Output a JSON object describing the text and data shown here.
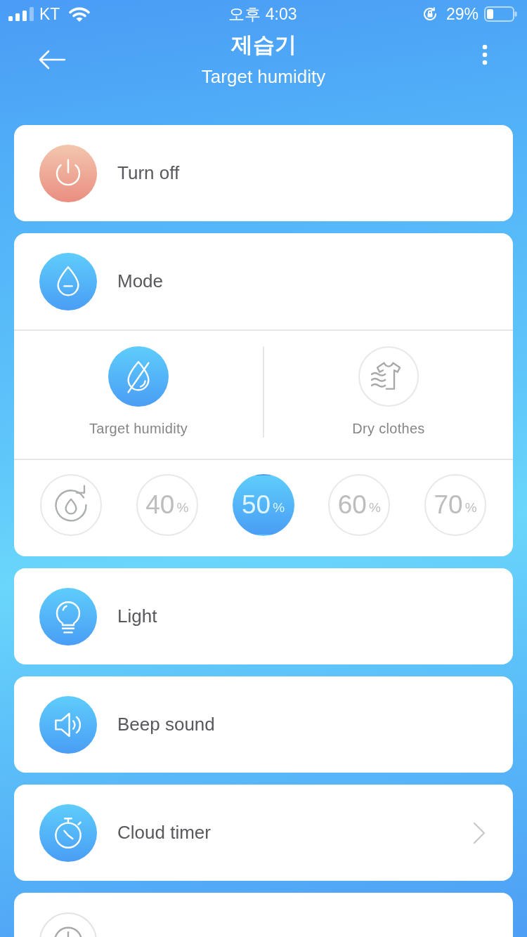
{
  "status_bar": {
    "carrier": "KT",
    "time": "오후 4:03",
    "battery": "29%"
  },
  "header": {
    "title": "제습기",
    "subtitle": "Target humidity"
  },
  "sections": [
    {
      "kind": "power",
      "label": "Turn off",
      "active": true,
      "chevron": false
    },
    {
      "kind": "mode",
      "label": "Mode",
      "active": true,
      "options": [
        {
          "kind": "humidity",
          "label": "Target humidity",
          "selected": true
        },
        {
          "kind": "clothes",
          "label": "Dry clothes",
          "selected": false
        }
      ],
      "levels": [
        {
          "kind": "auto",
          "selected": false
        },
        {
          "kind": "value",
          "value": "40",
          "unit": "%",
          "selected": false
        },
        {
          "kind": "value",
          "value": "50",
          "unit": "%",
          "selected": true
        },
        {
          "kind": "value",
          "value": "60",
          "unit": "%",
          "selected": false
        },
        {
          "kind": "value",
          "value": "70",
          "unit": "%",
          "selected": false
        }
      ]
    },
    {
      "kind": "light",
      "label": "Light",
      "active": true,
      "chevron": false
    },
    {
      "kind": "sound",
      "label": "Beep sound",
      "active": true,
      "chevron": false
    },
    {
      "kind": "timer",
      "label": "Cloud timer",
      "active": true,
      "chevron": true
    },
    {
      "kind": "clock",
      "active": false,
      "chevron": false
    }
  ]
}
